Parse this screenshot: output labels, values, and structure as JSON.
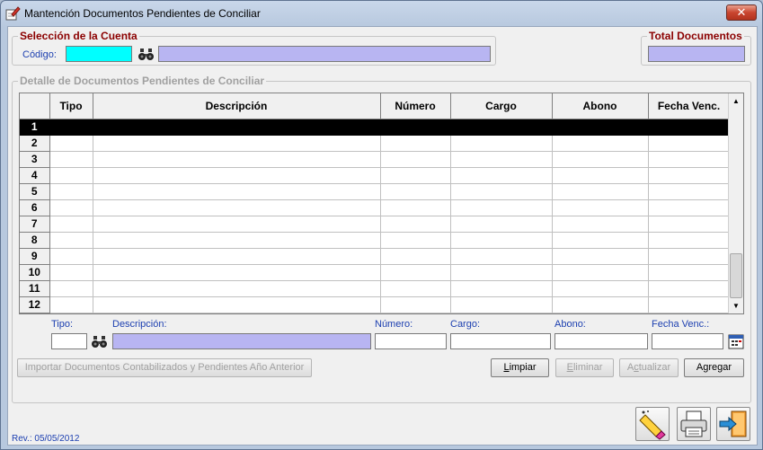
{
  "window": {
    "title": "Mantención Documentos Pendientes de Conciliar",
    "close_label": "✕"
  },
  "account_group": {
    "legend": "Selección de la Cuenta",
    "code_label": "Código:",
    "code_value": "",
    "name_value": ""
  },
  "total_group": {
    "legend": "Total Documentos",
    "value": ""
  },
  "detail_group": {
    "legend": "Detalle de Documentos Pendientes de Conciliar"
  },
  "grid": {
    "columns": [
      "Tipo",
      "Descripción",
      "Número",
      "Cargo",
      "Abono",
      "Fecha Venc."
    ],
    "row_numbers": [
      "1",
      "2",
      "3",
      "4",
      "5",
      "6",
      "7",
      "8",
      "9",
      "10",
      "11",
      "12"
    ],
    "selected_row": 1
  },
  "entry": {
    "tipo_label": "Tipo:",
    "descripcion_label": "Descripción:",
    "numero_label": "Número:",
    "cargo_label": "Cargo:",
    "abono_label": "Abono:",
    "fecha_label": "Fecha Venc.:",
    "tipo_value": "",
    "descripcion_value": "",
    "numero_value": "",
    "cargo_value": "",
    "abono_value": "",
    "fecha_value": ""
  },
  "buttons": {
    "import_label": "Importar Documentos Contabilizados y Pendientes Año Anterior",
    "limpiar_first": "L",
    "limpiar_rest": "impiar",
    "eliminar_first": "E",
    "eliminar_rest": "liminar",
    "actualizar_pre": "A",
    "actualizar_u": "c",
    "actualizar_rest": "tualizar",
    "agregar_pre": "A",
    "agregar_u": "g",
    "agregar_rest": "regar"
  },
  "icons": {
    "app": "edit-document-icon",
    "binoculars": "binoculars-icon",
    "calendar": "calendar-icon",
    "eraser": "eraser-icon",
    "printer": "printer-icon",
    "exit": "exit-door-icon"
  },
  "footer": {
    "revision": "Rev.: 05/05/2012"
  },
  "colors": {
    "code_field": "#00ffff",
    "readonly_field": "#b8b5f2",
    "legend_red": "#8b0000",
    "label_blue": "#1c3fb0"
  }
}
